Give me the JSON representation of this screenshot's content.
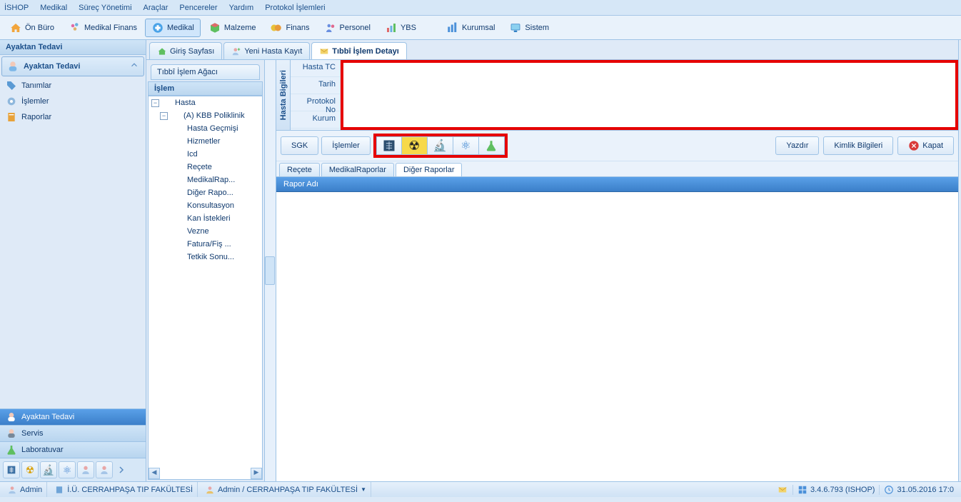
{
  "menu": {
    "items": [
      "İSHOP",
      "Medikal",
      "Süreç Yönetimi",
      "Araçlar",
      "Pencereler",
      "Yardım",
      "Protokol İşlemleri"
    ]
  },
  "ribbon": {
    "items": [
      {
        "label": "Ön Büro",
        "icon": "house"
      },
      {
        "label": "Medikal Finans",
        "icon": "wand"
      },
      {
        "label": "Medikal",
        "icon": "medikal",
        "active": true
      },
      {
        "label": "Malzeme",
        "icon": "cube"
      },
      {
        "label": "Finans",
        "icon": "money"
      },
      {
        "label": "Personel",
        "icon": "people"
      },
      {
        "label": "YBS",
        "icon": "chart"
      },
      {
        "label": "Kurumsal",
        "icon": "barchart"
      },
      {
        "label": "Sistem",
        "icon": "monitor"
      }
    ]
  },
  "sidebar": {
    "title": "Ayaktan Tedavi",
    "panel_label": "Ayaktan Tedavi",
    "items": [
      {
        "label": "Tanımlar",
        "icon": "tag"
      },
      {
        "label": "İşlemler",
        "icon": "gear"
      },
      {
        "label": "Raporlar",
        "icon": "report"
      }
    ],
    "groups": [
      {
        "label": "Ayaktan Tedavi",
        "selected": true
      },
      {
        "label": "Servis"
      },
      {
        "label": "Laboratuvar"
      }
    ]
  },
  "main_tabs": [
    {
      "label": "Giriş Sayfası",
      "icon": "home"
    },
    {
      "label": "Yeni Hasta Kayıt",
      "icon": "newuser"
    },
    {
      "label": "Tıbbî İşlem Detayı",
      "icon": "mail",
      "active": true
    }
  ],
  "tree": {
    "tab": "Tıbbî İşlem Ağacı",
    "header": "İşlem",
    "nodes": {
      "root": "Hasta",
      "clinic": "(A) KBB Poliklinik",
      "children": [
        "Hasta Geçmişi",
        "Hizmetler",
        "Icd",
        "Reçete",
        "MedikalRap...",
        "Diğer Rapo...",
        "Konsultasyon",
        "Kan İstekleri",
        "Vezne",
        "Fatura/Fiş ...",
        "Tetkik Sonu..."
      ]
    }
  },
  "info": {
    "vertical_label": "Hasta Bigileri",
    "rows": [
      "Hasta TC",
      "Tarih",
      "Protokol No",
      "Kurum"
    ]
  },
  "actions": {
    "sgk": "SGK",
    "islemler": "İşlemler",
    "yazdir": "Yazdır",
    "kimlik": "Kimlik Bilgileri",
    "kapat": "Kapat"
  },
  "sub_tabs": [
    {
      "label": "Reçete"
    },
    {
      "label": "MedikalRaporlar"
    },
    {
      "label": "Diğer Raporlar",
      "active": true
    }
  ],
  "report_header": "Rapor Adı",
  "status": {
    "user": "Admin",
    "org_full": "İ.Ü. CERRAHPAŞA TIP FAKÜLTESİ",
    "user_org": "Admin / CERRAHPAŞA TIP FAKÜLTESİ",
    "version": "3.4.6.793 (ISHOP)",
    "datetime": "31.05.2016 17:0"
  }
}
